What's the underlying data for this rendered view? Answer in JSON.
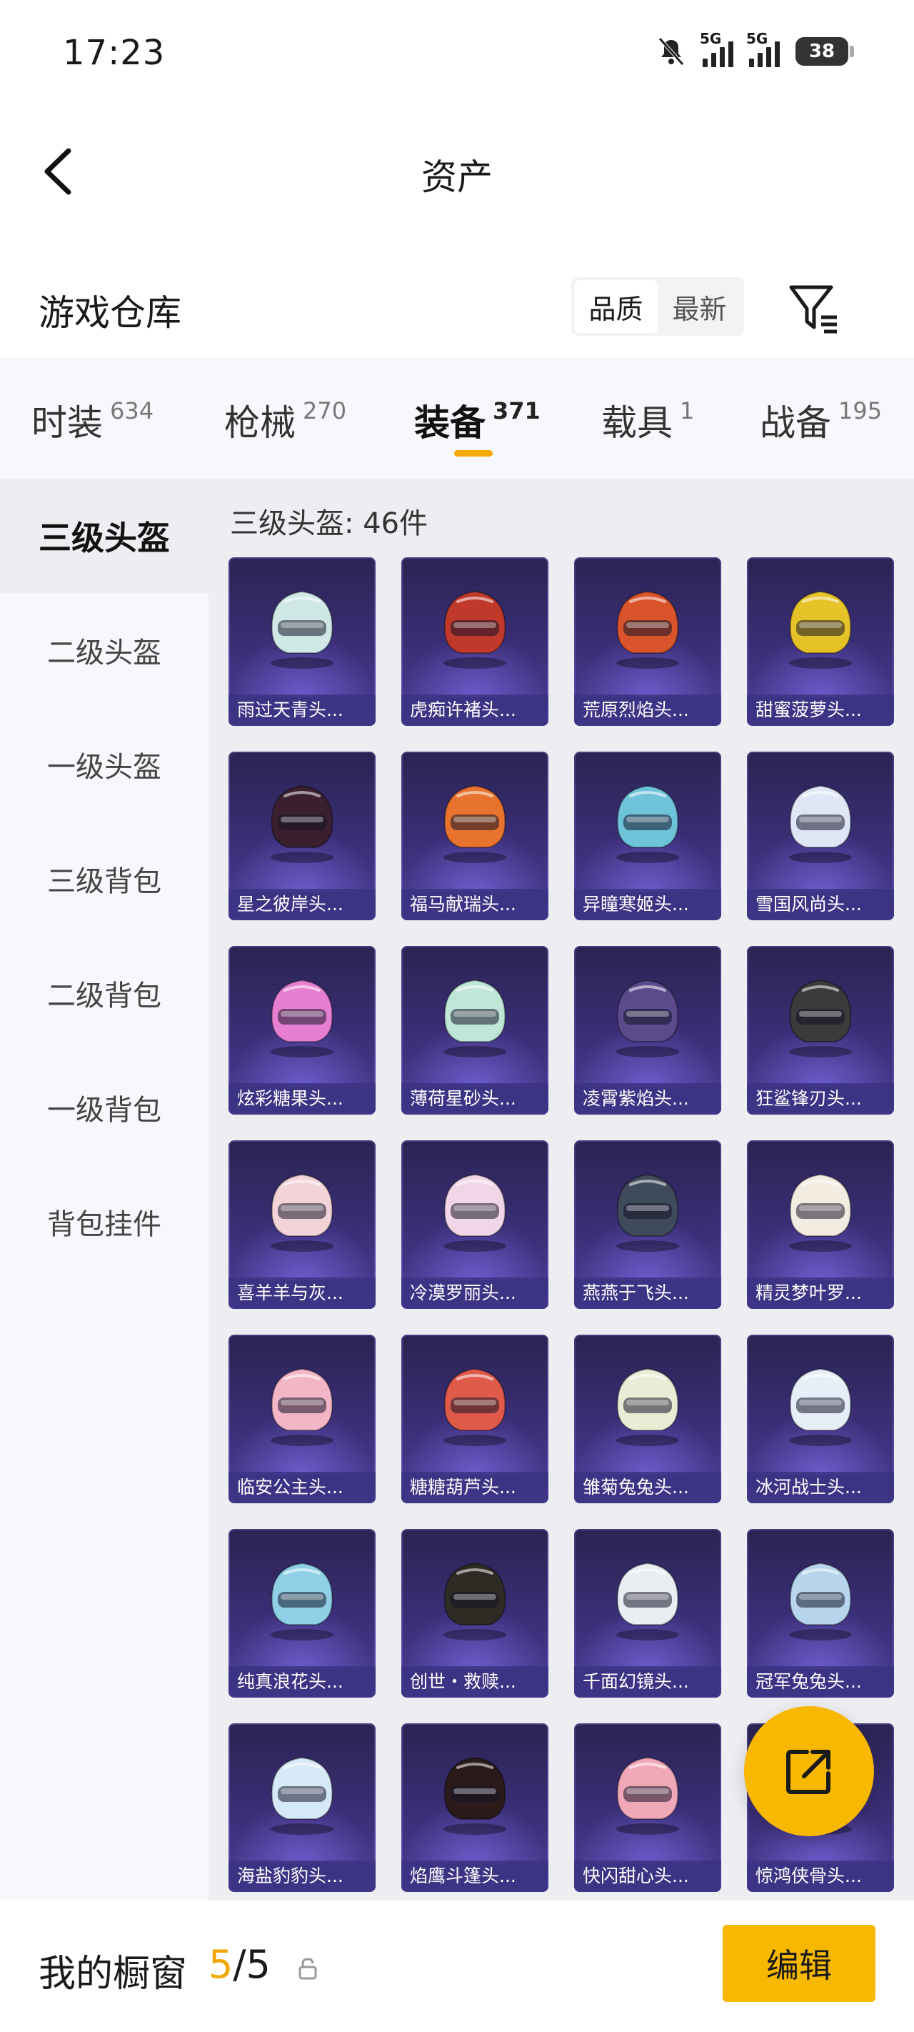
{
  "status": {
    "time": "17:23",
    "net1": "5G",
    "net2": "5G",
    "battery": "38"
  },
  "header": {
    "title": "资产"
  },
  "warehouse": {
    "title": "游戏仓库",
    "sort_options": [
      "品质",
      "最新"
    ],
    "active_sort": 0
  },
  "tabs": [
    {
      "label": "时装",
      "count": "634"
    },
    {
      "label": "枪械",
      "count": "270"
    },
    {
      "label": "装备",
      "count": "371",
      "active": true
    },
    {
      "label": "载具",
      "count": "1"
    },
    {
      "label": "战备",
      "count": "195"
    }
  ],
  "sidebar": {
    "items": [
      "三级头盔",
      "二级头盔",
      "一级头盔",
      "三级背包",
      "二级背包",
      "一级背包",
      "背包挂件"
    ],
    "active": 0
  },
  "content": {
    "heading": "三级头盔: 46件",
    "items": [
      {
        "name": "雨过天青头...",
        "color": "#cfe8e6"
      },
      {
        "name": "虎痴许褚头...",
        "color": "#c0392b"
      },
      {
        "name": "荒原烈焰头...",
        "color": "#d9542b"
      },
      {
        "name": "甜蜜菠萝头...",
        "color": "#e6c229"
      },
      {
        "name": "星之彼岸头...",
        "color": "#3a1f2e"
      },
      {
        "name": "福马献瑞头...",
        "color": "#e8732e"
      },
      {
        "name": "异瞳寒姬头...",
        "color": "#6fc3d9"
      },
      {
        "name": "雪国风尚头...",
        "color": "#dfe6f5"
      },
      {
        "name": "炫彩糖果头...",
        "color": "#e77fd0"
      },
      {
        "name": "薄荷星砂头...",
        "color": "#bfe6d6"
      },
      {
        "name": "凌霄紫焰头...",
        "color": "#5b4a8c"
      },
      {
        "name": "狂鲨锋刃头...",
        "color": "#3b3b3b"
      },
      {
        "name": "喜羊羊与灰...",
        "color": "#f1d3d8"
      },
      {
        "name": "冷漠罗丽头...",
        "color": "#f0d6e6"
      },
      {
        "name": "燕燕于飞头...",
        "color": "#3f4a5a"
      },
      {
        "name": "精灵梦叶罗...",
        "color": "#f3ece0"
      },
      {
        "name": "临安公主头...",
        "color": "#f2b6c6"
      },
      {
        "name": "糖糖葫芦头...",
        "color": "#e05a4a"
      },
      {
        "name": "雏菊兔兔头...",
        "color": "#e8eed6"
      },
      {
        "name": "冰河战士头...",
        "color": "#e6eef8"
      },
      {
        "name": "纯真浪花头...",
        "color": "#8fd0e6"
      },
      {
        "name": "创世・救赎...",
        "color": "#2e2a24"
      },
      {
        "name": "千面幻镜头...",
        "color": "#e8eef2"
      },
      {
        "name": "冠军兔兔头...",
        "color": "#b7d6ee"
      },
      {
        "name": "海盐豹豹头...",
        "color": "#d6e9f6"
      },
      {
        "name": "焰鹰斗篷头...",
        "color": "#2a1a1a"
      },
      {
        "name": "快闪甜心头...",
        "color": "#f0a8b8"
      },
      {
        "name": "惊鸿侠骨头...",
        "color": "#c9d3e6"
      }
    ]
  },
  "bottom": {
    "label": "我的橱窗",
    "current": "5",
    "total": "/5",
    "edit": "编辑"
  },
  "colors": {
    "accent": "#f8b800",
    "card_bg": "#3b2f78"
  }
}
